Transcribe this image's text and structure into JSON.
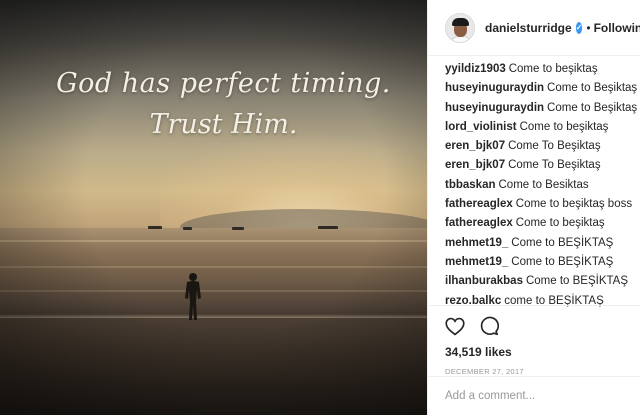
{
  "photo": {
    "quote_line1": "God has perfect timing.",
    "quote_line2": "Trust Him."
  },
  "header": {
    "username": "danielsturridge",
    "verified_icon": "check",
    "separator": "•",
    "follow_status": "Following"
  },
  "comments": [
    {
      "user": "yyildiz1903",
      "text": "Come to beşiktaş"
    },
    {
      "user": "huseyinuguraydin",
      "text": "Come to Beşiktaş"
    },
    {
      "user": "huseyinuguraydin",
      "text": "Come to Beşiktaş"
    },
    {
      "user": "lord_violinist",
      "text": "Come to beşiktaş"
    },
    {
      "user": "eren_bjk07",
      "text": "Come To Beşiktaş"
    },
    {
      "user": "eren_bjk07",
      "text": "Come To Beşiktaş"
    },
    {
      "user": "tbbaskan",
      "text": "Come to Besiktas"
    },
    {
      "user": "fathereaglex",
      "text": "Come to beşiktaş boss"
    },
    {
      "user": "fathereaglex",
      "text": "Come to beşiktaş"
    },
    {
      "user": "mehmet19_",
      "text": "Come to BEŞİKTAŞ"
    },
    {
      "user": "mehmet19_",
      "text": "Come to BEŞİKTAŞ"
    },
    {
      "user": "ilhanburakbas",
      "text": "Come to BEŞİKTAŞ"
    },
    {
      "user": "rezo.balkc",
      "text": "come to BEŞİKTAŞ"
    }
  ],
  "actions": {
    "like_icon": "heart-outline",
    "comment_icon": "speech-bubble-outline",
    "likes": "34,519 likes",
    "date": "DECEMBER 27, 2017"
  },
  "add_comment": {
    "placeholder": "Add a comment..."
  }
}
